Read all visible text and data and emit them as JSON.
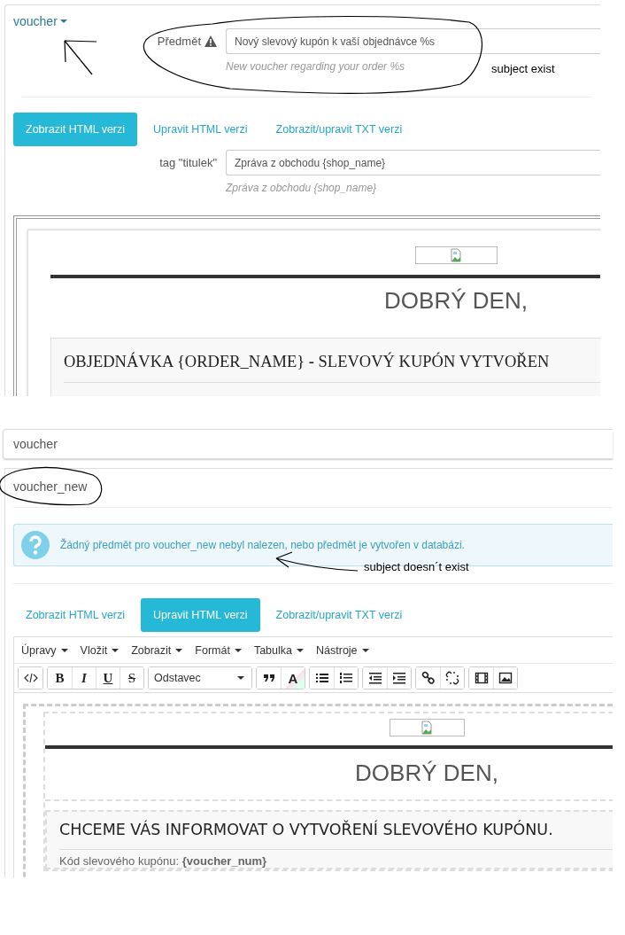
{
  "section_1": {
    "title": "voucher",
    "expanded": true,
    "subject": {
      "label": "Předmět",
      "value": "Nový slevový kupón k vaší objednávce %s",
      "hint": "New voucher regarding your order %s"
    },
    "tabs": [
      {
        "label": "Zobrazit HTML verzi",
        "selected": true
      },
      {
        "label": "Upravit HTML verzi",
        "selected": false
      },
      {
        "label": "Zobrazit/upravit TXT verzi",
        "selected": false
      }
    ],
    "tag_field": {
      "label": "tag \"titulek\"",
      "value": "Zpráva z obchodu {shop_name}",
      "hint": "Zpráva z obchodu {shop_name}"
    },
    "preview": {
      "greeting": "DOBRÝ DEN,",
      "heading": "OBJEDNÁVKA {ORDER_NAME} **-** SLEVOVÝ KUPÓN VYTVOŘEN"
    }
  },
  "collapsed_item": {
    "title": "voucher"
  },
  "section_2": {
    "title": "voucher_new",
    "alert": "Žádný předmět pro voucher_new nebyl nalezen, nebo předmět je vytvořen v databázi.",
    "tabs": [
      {
        "label": "Zobrazit HTML verzi",
        "selected": false
      },
      {
        "label": "Upravit HTML verzi",
        "selected": true
      },
      {
        "label": "Zobrazit/upravit TXT verzi",
        "selected": false
      }
    ],
    "editor": {
      "menus": [
        "Úpravy",
        "Vložit",
        "Zobrazit",
        "Formát",
        "Tabulka",
        "Nástroje"
      ],
      "toolbar": [
        [
          {
            "kind": "code"
          }
        ],
        [
          {
            "kind": "bold",
            "label": "B"
          },
          {
            "kind": "italic",
            "label": "I"
          },
          {
            "kind": "underline",
            "label": "U"
          },
          {
            "kind": "strike",
            "label": "S"
          }
        ],
        [
          {
            "kind": "dropdown",
            "label": "Odstavec"
          }
        ],
        [
          {
            "kind": "quote"
          },
          {
            "kind": "textcolor",
            "label": "A"
          }
        ],
        [
          {
            "kind": "bullets"
          },
          {
            "kind": "numbers"
          }
        ],
        [
          {
            "kind": "outdent"
          },
          {
            "kind": "indent"
          }
        ],
        [
          {
            "kind": "link"
          },
          {
            "kind": "unlink"
          }
        ],
        [
          {
            "kind": "video"
          },
          {
            "kind": "image"
          }
        ]
      ],
      "greeting": "DOBRÝ DEN,",
      "heading": "CHCEME VÁS INFORMOVAT O VYTVOŘENÍ SLEVOVÉHO KUPÓNU.",
      "line": "Kód slevového kupónu: **{voucher_num}**"
    }
  },
  "annotations": [
    "subject exist",
    "subject doesn´t exist"
  ]
}
